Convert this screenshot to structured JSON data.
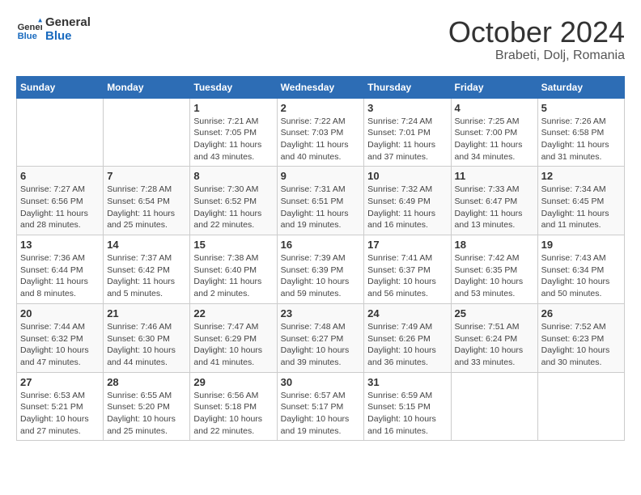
{
  "header": {
    "logo_line1": "General",
    "logo_line2": "Blue",
    "month": "October 2024",
    "location": "Brabeti, Dolj, Romania"
  },
  "days_of_week": [
    "Sunday",
    "Monday",
    "Tuesday",
    "Wednesday",
    "Thursday",
    "Friday",
    "Saturday"
  ],
  "weeks": [
    [
      {
        "day": "",
        "detail": ""
      },
      {
        "day": "",
        "detail": ""
      },
      {
        "day": "1",
        "detail": "Sunrise: 7:21 AM\nSunset: 7:05 PM\nDaylight: 11 hours and 43 minutes."
      },
      {
        "day": "2",
        "detail": "Sunrise: 7:22 AM\nSunset: 7:03 PM\nDaylight: 11 hours and 40 minutes."
      },
      {
        "day": "3",
        "detail": "Sunrise: 7:24 AM\nSunset: 7:01 PM\nDaylight: 11 hours and 37 minutes."
      },
      {
        "day": "4",
        "detail": "Sunrise: 7:25 AM\nSunset: 7:00 PM\nDaylight: 11 hours and 34 minutes."
      },
      {
        "day": "5",
        "detail": "Sunrise: 7:26 AM\nSunset: 6:58 PM\nDaylight: 11 hours and 31 minutes."
      }
    ],
    [
      {
        "day": "6",
        "detail": "Sunrise: 7:27 AM\nSunset: 6:56 PM\nDaylight: 11 hours and 28 minutes."
      },
      {
        "day": "7",
        "detail": "Sunrise: 7:28 AM\nSunset: 6:54 PM\nDaylight: 11 hours and 25 minutes."
      },
      {
        "day": "8",
        "detail": "Sunrise: 7:30 AM\nSunset: 6:52 PM\nDaylight: 11 hours and 22 minutes."
      },
      {
        "day": "9",
        "detail": "Sunrise: 7:31 AM\nSunset: 6:51 PM\nDaylight: 11 hours and 19 minutes."
      },
      {
        "day": "10",
        "detail": "Sunrise: 7:32 AM\nSunset: 6:49 PM\nDaylight: 11 hours and 16 minutes."
      },
      {
        "day": "11",
        "detail": "Sunrise: 7:33 AM\nSunset: 6:47 PM\nDaylight: 11 hours and 13 minutes."
      },
      {
        "day": "12",
        "detail": "Sunrise: 7:34 AM\nSunset: 6:45 PM\nDaylight: 11 hours and 11 minutes."
      }
    ],
    [
      {
        "day": "13",
        "detail": "Sunrise: 7:36 AM\nSunset: 6:44 PM\nDaylight: 11 hours and 8 minutes."
      },
      {
        "day": "14",
        "detail": "Sunrise: 7:37 AM\nSunset: 6:42 PM\nDaylight: 11 hours and 5 minutes."
      },
      {
        "day": "15",
        "detail": "Sunrise: 7:38 AM\nSunset: 6:40 PM\nDaylight: 11 hours and 2 minutes."
      },
      {
        "day": "16",
        "detail": "Sunrise: 7:39 AM\nSunset: 6:39 PM\nDaylight: 10 hours and 59 minutes."
      },
      {
        "day": "17",
        "detail": "Sunrise: 7:41 AM\nSunset: 6:37 PM\nDaylight: 10 hours and 56 minutes."
      },
      {
        "day": "18",
        "detail": "Sunrise: 7:42 AM\nSunset: 6:35 PM\nDaylight: 10 hours and 53 minutes."
      },
      {
        "day": "19",
        "detail": "Sunrise: 7:43 AM\nSunset: 6:34 PM\nDaylight: 10 hours and 50 minutes."
      }
    ],
    [
      {
        "day": "20",
        "detail": "Sunrise: 7:44 AM\nSunset: 6:32 PM\nDaylight: 10 hours and 47 minutes."
      },
      {
        "day": "21",
        "detail": "Sunrise: 7:46 AM\nSunset: 6:30 PM\nDaylight: 10 hours and 44 minutes."
      },
      {
        "day": "22",
        "detail": "Sunrise: 7:47 AM\nSunset: 6:29 PM\nDaylight: 10 hours and 41 minutes."
      },
      {
        "day": "23",
        "detail": "Sunrise: 7:48 AM\nSunset: 6:27 PM\nDaylight: 10 hours and 39 minutes."
      },
      {
        "day": "24",
        "detail": "Sunrise: 7:49 AM\nSunset: 6:26 PM\nDaylight: 10 hours and 36 minutes."
      },
      {
        "day": "25",
        "detail": "Sunrise: 7:51 AM\nSunset: 6:24 PM\nDaylight: 10 hours and 33 minutes."
      },
      {
        "day": "26",
        "detail": "Sunrise: 7:52 AM\nSunset: 6:23 PM\nDaylight: 10 hours and 30 minutes."
      }
    ],
    [
      {
        "day": "27",
        "detail": "Sunrise: 6:53 AM\nSunset: 5:21 PM\nDaylight: 10 hours and 27 minutes."
      },
      {
        "day": "28",
        "detail": "Sunrise: 6:55 AM\nSunset: 5:20 PM\nDaylight: 10 hours and 25 minutes."
      },
      {
        "day": "29",
        "detail": "Sunrise: 6:56 AM\nSunset: 5:18 PM\nDaylight: 10 hours and 22 minutes."
      },
      {
        "day": "30",
        "detail": "Sunrise: 6:57 AM\nSunset: 5:17 PM\nDaylight: 10 hours and 19 minutes."
      },
      {
        "day": "31",
        "detail": "Sunrise: 6:59 AM\nSunset: 5:15 PM\nDaylight: 10 hours and 16 minutes."
      },
      {
        "day": "",
        "detail": ""
      },
      {
        "day": "",
        "detail": ""
      }
    ]
  ]
}
